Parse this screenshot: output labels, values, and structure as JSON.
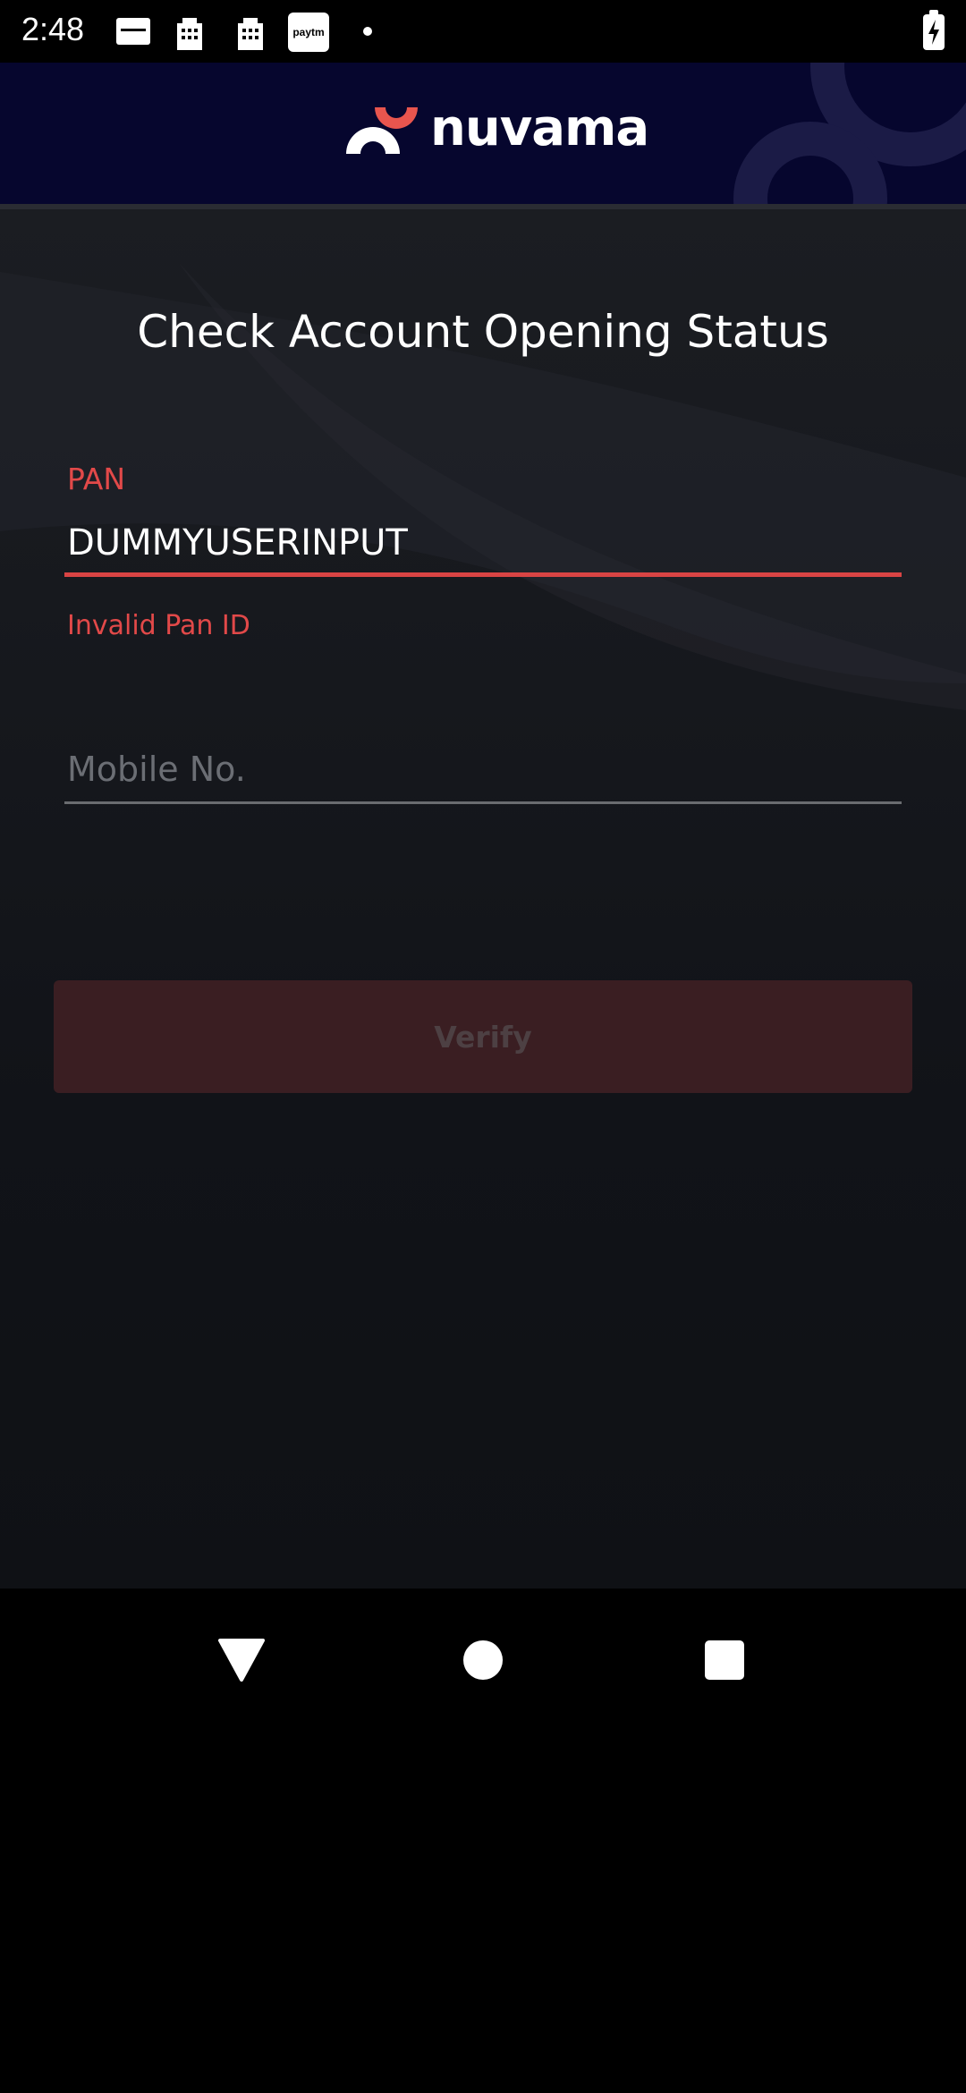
{
  "status_bar": {
    "time": "2:48",
    "notification_icons": [
      "credit-bureau-icon",
      "building-icon",
      "building-icon",
      "paytm-icon",
      "dot-icon"
    ],
    "paytm_label": "paytm",
    "battery_state": "charging"
  },
  "header": {
    "brand": "nuvama",
    "background_color": "#06062e",
    "accent_color": "#e8554e"
  },
  "page": {
    "title": "Check Account Opening Status"
  },
  "form": {
    "pan": {
      "label": "PAN",
      "value": "DUMMYUSERINPUT",
      "error": "Invalid Pan ID",
      "error_color": "#e24949"
    },
    "mobile": {
      "placeholder": "Mobile No.",
      "value": ""
    },
    "verify_button": {
      "label": "Verify",
      "enabled": false
    }
  },
  "nav_bar": {
    "buttons": [
      "back-icon",
      "home-icon",
      "recents-icon"
    ]
  }
}
